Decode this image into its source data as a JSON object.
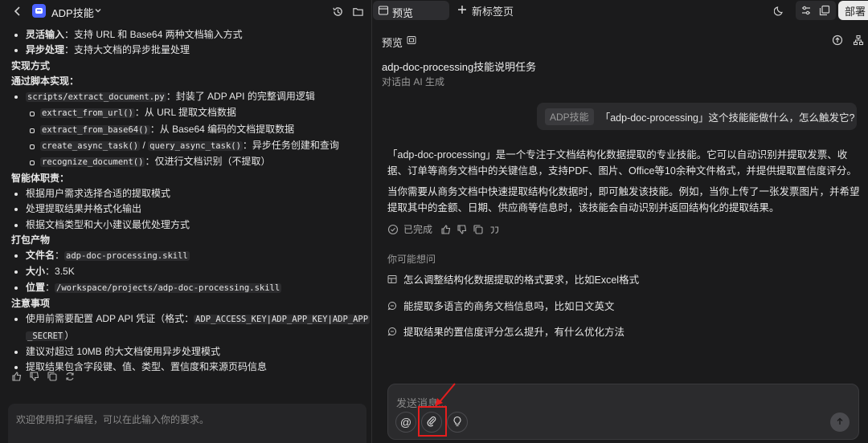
{
  "left": {
    "app_title": "ADP技能",
    "lines": [
      {
        "kind": "b1",
        "strong": "灵活输入",
        "text": "：支持 URL 和 Base64 两种文档输入方式"
      },
      {
        "kind": "b1",
        "strong": "异步处理",
        "text": "：支持大文档的异步批量处理"
      },
      {
        "kind": "h",
        "text": "实现方式"
      },
      {
        "kind": "h",
        "text": "通过脚本实现："
      },
      {
        "kind": "b1",
        "code": "scripts/extract_document.py",
        "text": "：封装了 ADP API 的完整调用逻辑"
      },
      {
        "kind": "b2",
        "code": "extract_from_url()",
        "text": "：从 URL 提取文档数据"
      },
      {
        "kind": "b2",
        "code": "extract_from_base64()",
        "text": "：从 Base64 编码的文档提取数据"
      },
      {
        "kind": "b2",
        "code": "create_async_task()",
        "mid": " / ",
        "code2": "query_async_task()",
        "text": "：异步任务创建和查询"
      },
      {
        "kind": "b2",
        "code": "recognize_document()",
        "text": "：仅进行文档识别（不提取）"
      },
      {
        "kind": "h",
        "text": "智能体职责："
      },
      {
        "kind": "b1",
        "text": "根据用户需求选择合适的提取模式"
      },
      {
        "kind": "b1",
        "text": "处理提取结果并格式化输出"
      },
      {
        "kind": "b1",
        "text": "根据文档类型和大小建议最优处理方式"
      },
      {
        "kind": "h",
        "text": "打包产物"
      },
      {
        "kind": "b1",
        "strong": "文件名",
        "text": "：",
        "code": "adp-doc-processing.skill"
      },
      {
        "kind": "b1",
        "strong": "大小",
        "text": "：3.5K"
      },
      {
        "kind": "b1",
        "strong": "位置",
        "text": "：",
        "code": "/workspace/projects/adp-doc-processing.skill"
      },
      {
        "kind": "h",
        "text": "注意事项"
      },
      {
        "kind": "b1",
        "text": "使用前需要配置 ADP API 凭证（格式：",
        "code": "ADP_ACCESS_KEY|ADP_APP_KEY|ADP_APP"
      },
      {
        "kind": "cont",
        "code": "_SECRET",
        "text": "）"
      },
      {
        "kind": "b1",
        "text": "建议对超过 10MB 的大文档使用异步处理模式"
      },
      {
        "kind": "b1",
        "text": "提取结果包含字段键、值、类型、置信度和来源页码信息"
      }
    ],
    "input_placeholder": "欢迎使用扣子编程，可以在此输入你的要求。"
  },
  "right": {
    "tab_preview": "预览",
    "new_tab": "新标签页",
    "deploy": "部署",
    "preview_header": "预览",
    "doc_title": "adp-doc-processing技能说明任务",
    "doc_sub": "对话由 AI 生成",
    "user_tag": "ADP技能",
    "user_msg": "「adp-doc-processing」这个技能能做什么，怎么触发它?",
    "answer_p1": "「adp-doc-processing」是一个专注于文档结构化数据提取的专业技能。它可以自动识别并提取发票、收据、订单等商务文档中的关键信息，支持PDF、图片、Office等10余种文件格式，并提供提取置信度评分。",
    "answer_p2": "当你需要从商务文档中快速提取结构化数据时，即可触发该技能。例如，当你上传了一张发票图片，并希望提取其中的金额、日期、供应商等信息时，该技能会自动识别并返回结构化的提取结果。",
    "done_label": "已完成",
    "suggest_label": "你可能想问",
    "suggestions": [
      "怎么调整结构化数据提取的格式要求，比如Excel格式",
      "能提取多语言的商务文档信息吗，比如日文英文",
      "提取结果的置信度评分怎么提升，有什么优化方法"
    ],
    "chat_placeholder": "发送消息...",
    "at_symbol": "@"
  },
  "colors": {
    "highlight": "#e41e1e",
    "logo": "#4b62ff"
  }
}
